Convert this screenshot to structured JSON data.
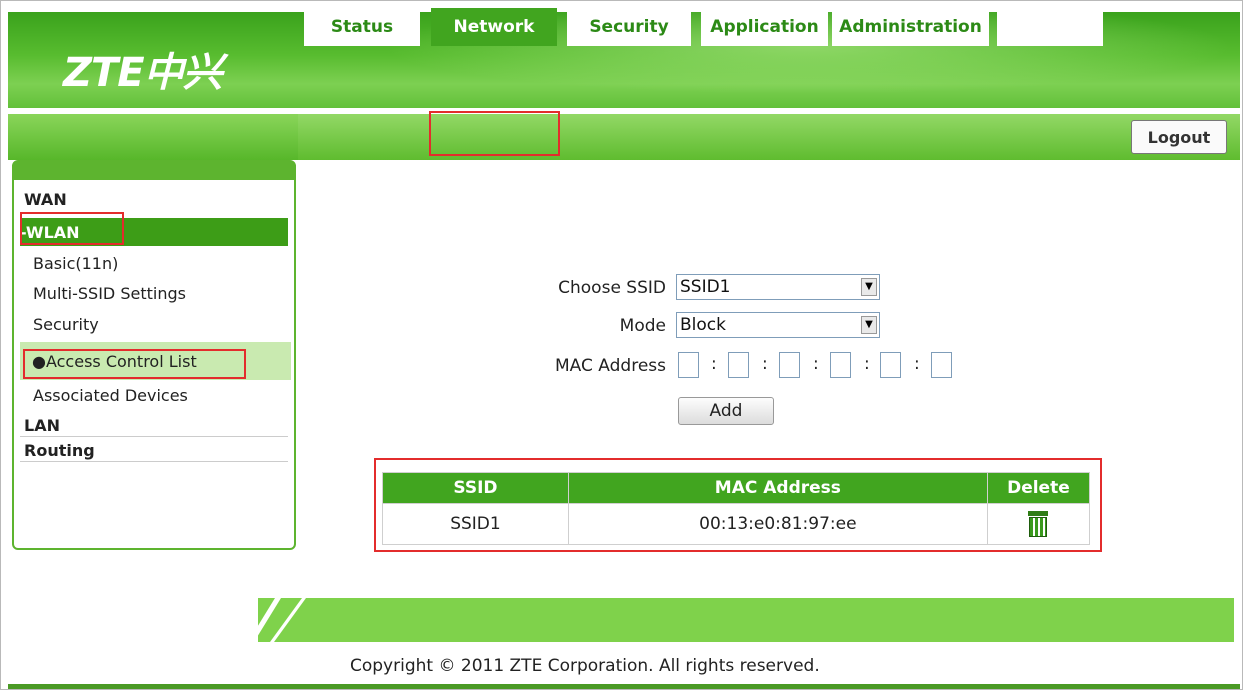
{
  "header": {
    "logo": "ZTE中兴"
  },
  "nav": {
    "tabs": [
      {
        "label": "Status"
      },
      {
        "label": "Network"
      },
      {
        "label": "Security"
      },
      {
        "label": "Application"
      },
      {
        "label": "Administration"
      }
    ],
    "active_tab": "Network",
    "logout_label": "Logout"
  },
  "sidebar": {
    "wan": "WAN",
    "wlan": "-WLAN",
    "items": [
      "Basic(11n)",
      "Multi-SSID Settings",
      "Security",
      "●Access Control List",
      "Associated Devices"
    ],
    "lan": "LAN",
    "routing": "Routing"
  },
  "form": {
    "ssid_label": "Choose SSID",
    "ssid_value": "SSID1",
    "mode_label": "Mode",
    "mode_value": "Block",
    "mac_label": "MAC Address",
    "add_label": "Add"
  },
  "table": {
    "headers": [
      "SSID",
      "MAC Address",
      "Delete"
    ],
    "rows": [
      {
        "ssid": "SSID1",
        "mac": "00:13:e0:81:97:ee"
      }
    ]
  },
  "footer": {
    "copyright": "Copyright © 2011 ZTE Corporation. All rights reserved."
  },
  "colors": {
    "brand_green": "#41a51f",
    "highlight_red": "#e32c2c"
  }
}
